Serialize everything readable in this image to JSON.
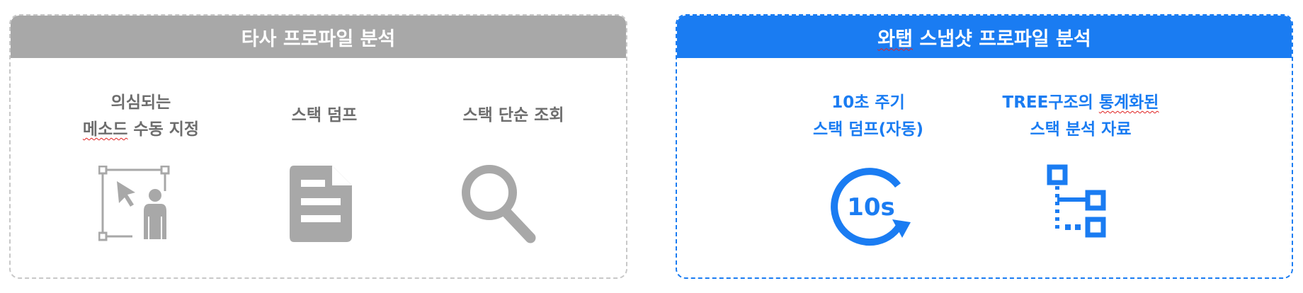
{
  "left_panel": {
    "title": "타사 프로파일 분석",
    "items": [
      {
        "line1": "의심되는",
        "line2_a": "메소드",
        "line2_b": " 수동 지정",
        "icon": "manual-select-icon"
      },
      {
        "line1": "스택 덤프",
        "icon": "document-icon"
      },
      {
        "line1": "스택 단순 조회",
        "icon": "search-icon"
      }
    ]
  },
  "right_panel": {
    "title_a": "와탭",
    "title_b": " 스냅샷 프로파일 분석",
    "items": [
      {
        "line1": "10초 주기",
        "line2": "스택 덤프(자동)",
        "icon": "timer-10s-icon",
        "icon_text": "10s"
      },
      {
        "line1_a": "TREE구조의 ",
        "line1_b": "통계화된",
        "line2": "스택 분석 자료",
        "icon": "tree-structure-icon"
      }
    ]
  },
  "colors": {
    "gray": "#a8a8a8",
    "blue": "#1a7cf2",
    "label_gray": "#6d6d6d"
  }
}
